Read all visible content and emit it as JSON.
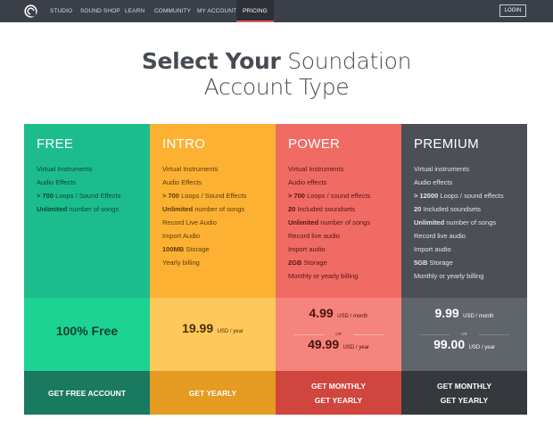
{
  "nav": {
    "logo_icon": "soundation-logo-icon",
    "links": [
      "STUDIO",
      "SOUND SHOP",
      "LEARN",
      "COMMUNITY",
      "MY ACCOUNT",
      "PRICING"
    ],
    "active": "PRICING",
    "login_label": "LOGIN"
  },
  "headline": {
    "line1_bold": "Select Your",
    "line1_rest": " Soundation",
    "line2": "Account Type"
  },
  "colors": {
    "free": "#1dbc8d",
    "intro": "#fdb132",
    "power": "#ef6b63",
    "premium": "#4c4f56",
    "nav_bg": "#3a3f48",
    "active_underline": "#e85a4f"
  },
  "plans": [
    {
      "name": "FREE",
      "features": [
        [
          {
            "t": "Virtual Instruments",
            "b": false
          }
        ],
        [
          {
            "t": "Audio Effects",
            "b": false
          }
        ],
        [
          {
            "t": "> 700",
            "b": true
          },
          {
            "t": " Loops / Sound Effects",
            "b": false
          }
        ],
        [
          {
            "t": "Unlimited",
            "b": true
          },
          {
            "t": " number of songs",
            "b": false
          }
        ]
      ],
      "price_text": "100% Free",
      "cta_lines": [
        "GET FREE ACCOUNT"
      ]
    },
    {
      "name": "INTRO",
      "features": [
        [
          {
            "t": "Virtual Instruments",
            "b": false
          }
        ],
        [
          {
            "t": "Audio Effects",
            "b": false
          }
        ],
        [
          {
            "t": "> 700",
            "b": true
          },
          {
            "t": " Loops / Sound Effects",
            "b": false
          }
        ],
        [
          {
            "t": "Unlimited",
            "b": true
          },
          {
            "t": " number of songs",
            "b": false
          }
        ],
        [
          {
            "t": "Record Live Audio",
            "b": false
          }
        ],
        [
          {
            "t": "Import Audio",
            "b": false
          }
        ],
        [
          {
            "t": "100MB",
            "b": true
          },
          {
            "t": " Storage",
            "b": false
          }
        ],
        [
          {
            "t": "Yearly billing",
            "b": false
          }
        ]
      ],
      "prices": [
        {
          "amount": "19.99",
          "unit": "USD / year"
        }
      ],
      "cta_lines": [
        "GET YEARLY"
      ]
    },
    {
      "name": "POWER",
      "features": [
        [
          {
            "t": "Virtual Instruments",
            "b": false
          }
        ],
        [
          {
            "t": "Audio effects",
            "b": false
          }
        ],
        [
          {
            "t": "> 700",
            "b": true
          },
          {
            "t": " Loops / sound effects",
            "b": false
          }
        ],
        [
          {
            "t": "20",
            "b": true
          },
          {
            "t": " Included soundsets",
            "b": false
          }
        ],
        [
          {
            "t": "Unlimited",
            "b": true
          },
          {
            "t": " number of songs",
            "b": false
          }
        ],
        [
          {
            "t": "Record live audio",
            "b": false
          }
        ],
        [
          {
            "t": "Import audio",
            "b": false
          }
        ],
        [
          {
            "t": "2GB",
            "b": true
          },
          {
            "t": " Storage",
            "b": false
          }
        ],
        [
          {
            "t": "Monthly or yearly billing",
            "b": false
          }
        ]
      ],
      "prices": [
        {
          "amount": "4.99",
          "unit": "USD / month"
        },
        {
          "amount": "49.99",
          "unit": "USD / year"
        }
      ],
      "or_label": "OR",
      "cta_lines": [
        "GET MONTHLY",
        "GET YEARLY"
      ]
    },
    {
      "name": "PREMIUM",
      "features": [
        [
          {
            "t": "Virtual instruments",
            "b": false
          }
        ],
        [
          {
            "t": "Audio effects",
            "b": false
          }
        ],
        [
          {
            "t": "> 12000",
            "b": true
          },
          {
            "t": " Loops / sound effects",
            "b": false
          }
        ],
        [
          {
            "t": "20",
            "b": true
          },
          {
            "t": " Included soundsets",
            "b": false
          }
        ],
        [
          {
            "t": "Unlimited",
            "b": true
          },
          {
            "t": " number of songs",
            "b": false
          }
        ],
        [
          {
            "t": "Record live audio",
            "b": false
          }
        ],
        [
          {
            "t": "Import audio",
            "b": false
          }
        ],
        [
          {
            "t": "5GB",
            "b": true
          },
          {
            "t": " Storage",
            "b": false
          }
        ],
        [
          {
            "t": "Monthly or yearly billing",
            "b": false
          }
        ]
      ],
      "prices": [
        {
          "amount": "9.99",
          "unit": "USD / month"
        },
        {
          "amount": "99.00",
          "unit": "USD / year"
        }
      ],
      "or_label": "OR",
      "cta_lines": [
        "GET MONTHLY",
        "GET YEARLY"
      ]
    }
  ]
}
